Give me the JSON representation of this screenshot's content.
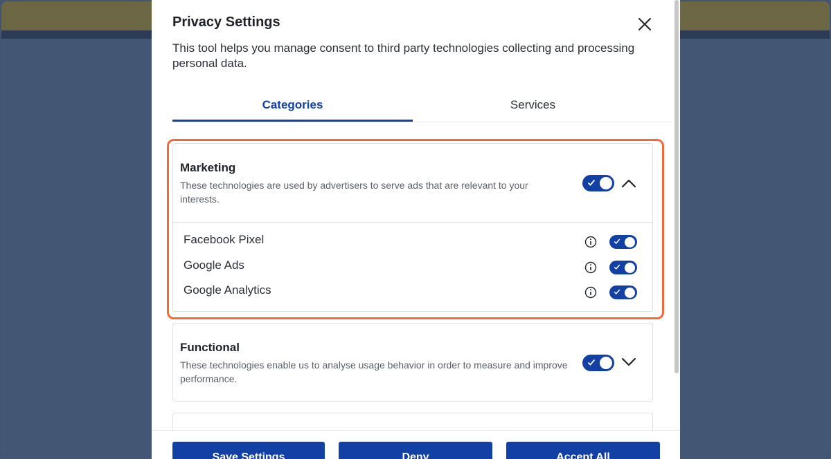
{
  "modal": {
    "title": "Privacy Settings",
    "description": "This tool helps you manage consent to third party technologies collecting and processing personal data."
  },
  "tabs": [
    {
      "label": "Categories",
      "active": true
    },
    {
      "label": "Services",
      "active": false
    }
  ],
  "categories": [
    {
      "title": "Marketing",
      "description": "These technologies are used by advertisers to serve ads that are relevant to your interests.",
      "enabled": true,
      "expanded": true,
      "services": [
        {
          "label": "Facebook Pixel",
          "enabled": true
        },
        {
          "label": "Google Ads",
          "enabled": true
        },
        {
          "label": "Google Analytics",
          "enabled": true
        }
      ]
    },
    {
      "title": "Functional",
      "description": "These technologies enable us to analyse usage behavior in order to measure and improve performance.",
      "enabled": true,
      "expanded": false
    }
  ],
  "footer": {
    "save_label": "Save Settings",
    "deny_label": "Deny",
    "accept_label": "Accept All"
  },
  "colors": {
    "accent": "#1340a5",
    "highlight": "#f06a3a",
    "topbar": "#6c6744",
    "page_background": "#435674"
  },
  "icons": [
    "close-icon",
    "chevron-up-icon",
    "chevron-down-icon",
    "info-icon",
    "check-icon"
  ]
}
